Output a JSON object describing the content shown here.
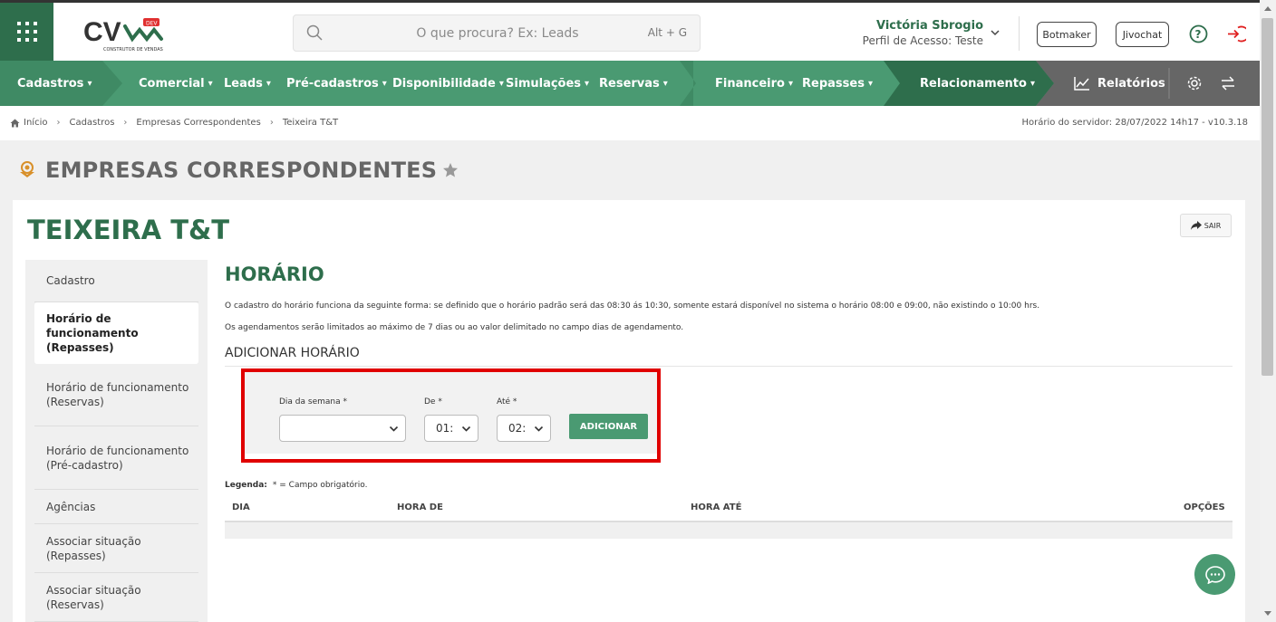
{
  "header": {
    "logo_text": "CV",
    "logo_badge": "DEV",
    "logo_subtitle": "CONSTRUTOR DE VENDAS",
    "search_placeholder": "O que procura? Ex: Leads",
    "search_hotkey": "Alt + G",
    "user_name": "Victória Sbrogio",
    "user_profile": "Perfil de Acesso: Teste",
    "botmaker_label": "Botmaker",
    "jivochat_label": "Jivochat"
  },
  "nav": {
    "items": [
      "Cadastros",
      "Comercial",
      "Leads",
      "Pré-cadastros",
      "Disponibilidade",
      "Simulações",
      "Reservas",
      "Financeiro",
      "Repasses",
      "Relacionamento",
      "Relatórios"
    ]
  },
  "breadcrumb": {
    "items": [
      "Início",
      "Cadastros",
      "Empresas Correspondentes",
      "Teixeira T&T"
    ],
    "server_time": "Horário do servidor: 28/07/2022 14h17 - v10.3.18"
  },
  "page": {
    "title": "EMPRESAS CORRESPONDENTES",
    "entity_title": "TEIXEIRA T&T",
    "exit_label": "SAIR"
  },
  "sidebar": {
    "items": [
      "Cadastro",
      "Horário de funcionamento (Repasses)",
      "Horário de funcionamento (Reservas)",
      "Horário de funcionamento (Pré-cadastro)",
      "Agências",
      "Associar situação (Repasses)",
      "Associar situação (Reservas)"
    ]
  },
  "main": {
    "section_title": "HORÁRIO",
    "info_1": "O cadastro do horário funciona da seguinte forma: se definido que o horário padrão será das 08:30 ás 10:30, somente estará disponível no sistema o horário 08:00 e 09:00, não existindo o 10:00 hrs.",
    "info_2": "Os agendamentos serão limitados ao máximo de 7 dias ou ao valor delimitado no campo dias de agendamento.",
    "add_title": "ADICIONAR HORÁRIO",
    "form": {
      "day_label": "Dia da semana *",
      "day_value": "",
      "from_label": "De *",
      "from_value": "01:",
      "to_label": "Até *",
      "to_value": "02:",
      "add_button": "ADICIONAR"
    },
    "legend_label": "Legenda:",
    "legend_text": "* = Campo obrigatório.",
    "table": {
      "headers": [
        "DIA",
        "HORA DE",
        "HORA ATÉ",
        "OPÇÕES"
      ]
    }
  },
  "colors": {
    "brand_dark": "#2e6e4c",
    "brand": "#4a9a72",
    "highlight_red": "#e00000"
  }
}
